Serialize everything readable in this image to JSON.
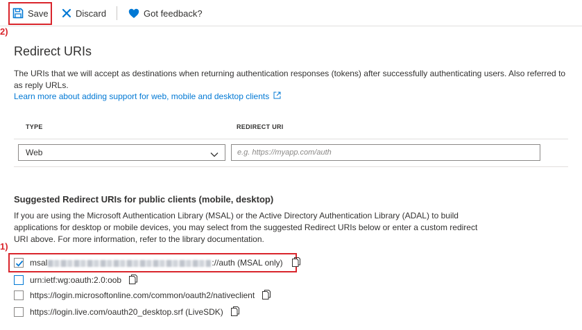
{
  "toolbar": {
    "save_label": "Save",
    "discard_label": "Discard",
    "feedback_label": "Got feedback?"
  },
  "annotations": {
    "step1": "1)",
    "step2": "2)"
  },
  "section": {
    "title": "Redirect URIs",
    "description": "The URIs that we will accept as destinations when returning authentication responses (tokens) after successfully authenticating users. Also referred to as reply URLs.",
    "learn_more_link": "Learn more about adding support for web, mobile and desktop clients"
  },
  "table": {
    "col_type": "TYPE",
    "col_redirect": "REDIRECT URI",
    "type_value": "Web",
    "uri_placeholder": "e.g. https://myapp.com/auth"
  },
  "suggested": {
    "title": "Suggested Redirect URIs for public clients (mobile, desktop)",
    "description": "If you are using the Microsoft Authentication Library (MSAL) or the Active Directory Authentication Library (ADAL) to build applications for desktop or mobile devices, you may select from the suggested Redirect URIs below or enter a custom redirect URI above. For more information, refer to the library documentation.",
    "items": [
      {
        "prefix": "msal",
        "suffix": "://auth (MSAL only)",
        "checked": true
      },
      {
        "label": "urn:ietf:wg:oauth:2.0:oob",
        "checked": false
      },
      {
        "label": "https://login.microsoftonline.com/common/oauth2/nativeclient",
        "checked": false
      },
      {
        "label": "https://login.live.com/oauth20_desktop.srf (LiveSDK)",
        "checked": false
      }
    ]
  },
  "colors": {
    "accent": "#0078d4",
    "annotation": "#d9242b",
    "text": "#323130"
  },
  "icons": {
    "save": "floppy-disk-icon",
    "discard": "x-icon",
    "feedback": "heart-icon",
    "external": "external-link-icon",
    "copy": "copy-icon",
    "chevron": "chevron-down-icon"
  }
}
